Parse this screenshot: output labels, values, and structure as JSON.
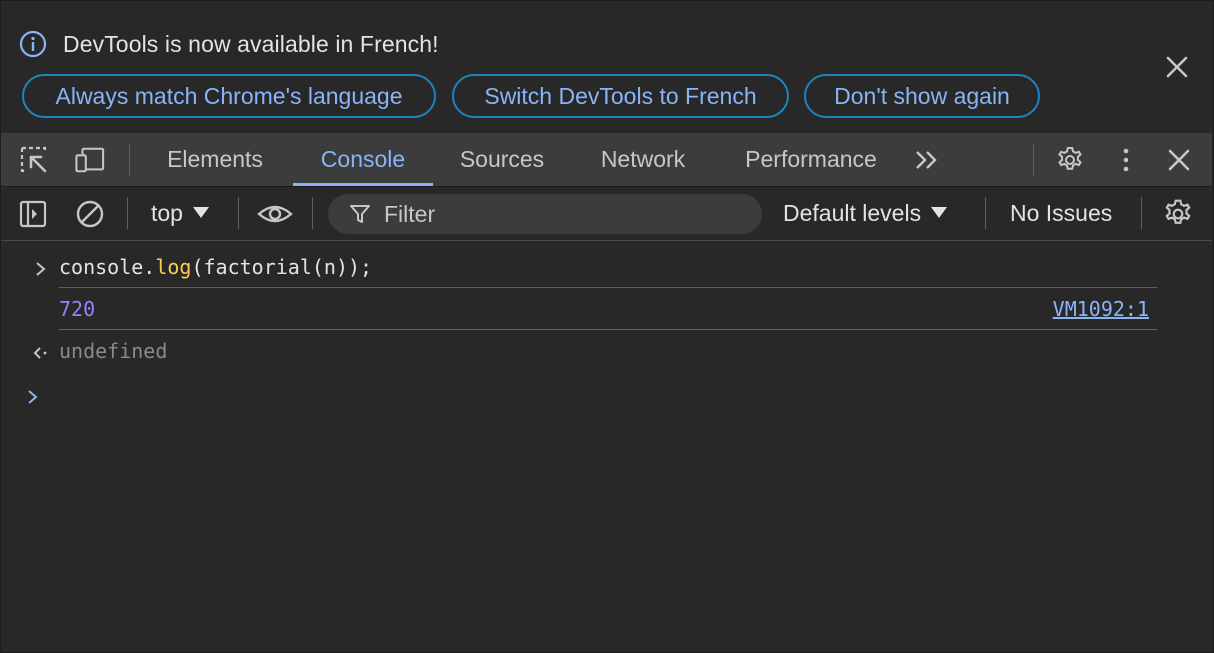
{
  "infobar": {
    "message": "DevTools is now available in French!",
    "buttons": [
      "Always match Chrome's language",
      "Switch DevTools to French",
      "Don't show again"
    ]
  },
  "tabs": {
    "items": [
      "Elements",
      "Console",
      "Sources",
      "Network",
      "Performance"
    ],
    "active": "Console"
  },
  "console_toolbar": {
    "context": "top",
    "filter_placeholder": "Filter",
    "levels": "Default levels",
    "issues": "No Issues"
  },
  "console": {
    "input": {
      "before": "console.",
      "fn": "log",
      "after": "(factorial(n));"
    },
    "output_value": "720",
    "source_link": "VM1092:1",
    "return_value": "undefined"
  },
  "colors": {
    "accent": "#8ab4f8",
    "number": "#9980ff",
    "function": "#f9ce54",
    "button_border": "#1c86c0"
  }
}
